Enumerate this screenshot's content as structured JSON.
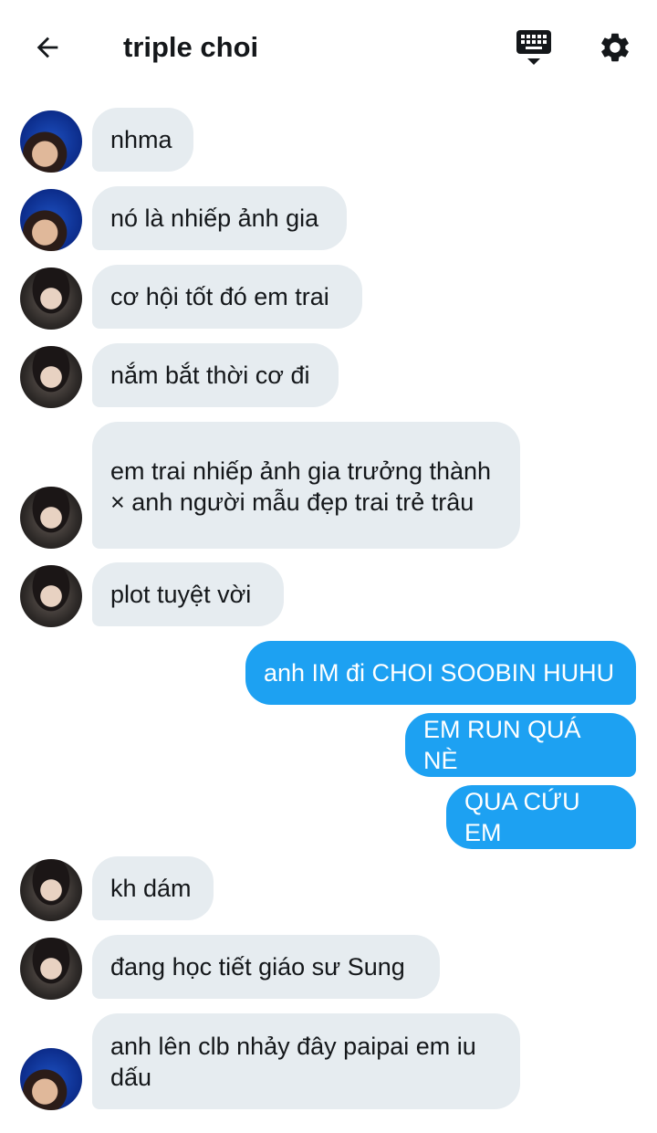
{
  "header": {
    "title": "triple choi",
    "back_icon": "arrow-left-icon",
    "keyboard_icon": "keyboard-icon",
    "settings_icon": "gear-icon"
  },
  "colors": {
    "incoming_bubble": "#e6ecf0",
    "outgoing_bubble": "#1da1f2",
    "text_dark": "#14171a"
  },
  "messages": [
    {
      "direction": "in",
      "avatar": "blue",
      "text": "nhma"
    },
    {
      "direction": "in",
      "avatar": "blue",
      "text": "nó là nhiếp ảnh gia"
    },
    {
      "direction": "in",
      "avatar": "dark",
      "text": "cơ hội tốt đó em trai"
    },
    {
      "direction": "in",
      "avatar": "dark",
      "text": "nắm bắt thời cơ đi"
    },
    {
      "direction": "in",
      "avatar": "dark",
      "text": "em trai nhiếp ảnh gia trưởng thành × anh người mẫu đẹp trai trẻ trâu"
    },
    {
      "direction": "in",
      "avatar": "dark",
      "text": "plot tuyệt vời"
    },
    {
      "direction": "out",
      "text": "anh IM đi CHOI SOOBIN HUHU"
    },
    {
      "direction": "out",
      "text": "EM RUN QUÁ NÈ"
    },
    {
      "direction": "out",
      "text": "QUA CỨU EM"
    },
    {
      "direction": "in",
      "avatar": "dark",
      "text": "kh dám"
    },
    {
      "direction": "in",
      "avatar": "dark",
      "text": "đang học tiết giáo sư Sung"
    },
    {
      "direction": "in",
      "avatar": "blue",
      "text": "anh lên clb nhảy đây paipai em iu dấu"
    }
  ]
}
